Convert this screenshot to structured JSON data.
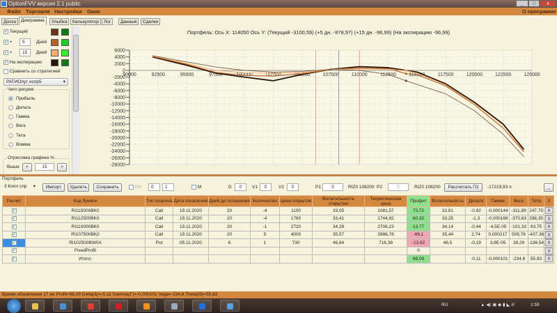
{
  "window": {
    "title": "OptionFVV версия 2.1 public",
    "minimize": "_",
    "maximize": "□",
    "close": "x"
  },
  "menu": {
    "items": [
      "Файл",
      "Торговля",
      "Настройки",
      "Окно"
    ],
    "about": "О программе"
  },
  "tabs": [
    "Доска",
    "Диаграмма",
    "Улыбка",
    "Калькулятор",
    "Лог",
    "Данные",
    "Сделки"
  ],
  "active_tab": "Диаграмма",
  "left_panel": {
    "series": [
      {
        "label": "Текущий",
        "checked": true,
        "color1": "#6b3518",
        "color2": "#0d7a1a"
      },
      {
        "prefix": "+",
        "days": "5",
        "label": "Дней",
        "checked": true,
        "color1": "#b5652a",
        "color2": "#22cc22"
      },
      {
        "prefix": "+",
        "days": "15",
        "label": "Дней",
        "checked": true,
        "color1": "#f5b070",
        "color2": "#33ee33"
      },
      {
        "label": "На экспирацию",
        "checked": true,
        "color1": "#2c1808",
        "color2": "#0d7a1a"
      }
    ],
    "compare_label": "Сравнить со стратегией",
    "compare_checked": false,
    "strategy_select": "РАТИОпут испр5",
    "draw_group": "Чего рисуем",
    "draw_options": [
      "Прибыль",
      "Дельта",
      "Гамма",
      "Вега",
      "Тета",
      "Вомма"
    ],
    "draw_selected": "Прибыль",
    "render_group": "Отрисовка графика %",
    "above_label": "Выше",
    "above_value": "15",
    "dec": "<",
    "inc": ">"
  },
  "chart_data": {
    "type": "line",
    "title": "Портфель:  Ось X:  114050  Ось Y:   (Текущий -3100,59)   (+5 дн. -978,97)   (+15 дн. -96,99)   (На экспирацию -96,99)",
    "xlim": [
      90000,
      125000
    ],
    "ylim": [
      -28000,
      6000
    ],
    "xticks": [
      90000,
      92500,
      95000,
      97500,
      100000,
      102500,
      105000,
      107500,
      110000,
      112500,
      115000,
      117500,
      120000,
      122500,
      125000
    ],
    "yticks": [
      6000,
      4000,
      2000,
      0,
      -2000,
      -4000,
      -6000,
      -8000,
      -10000,
      -12000,
      -14000,
      -16000,
      -18000,
      -20000,
      -22000,
      -24000,
      -26000,
      -28000
    ],
    "grid": true,
    "cursor_x": 114050,
    "current_price": 108200,
    "strike_markers": [
      106200,
      110000
    ],
    "series": [
      {
        "name": "Текущий",
        "color": "#2a1208",
        "x": [
          92000,
          95000,
          97500,
          100000,
          102500,
          105000,
          107500,
          110000,
          112500,
          115000,
          117500,
          120000,
          122500,
          124300
        ],
        "y": [
          4000,
          1500,
          -800,
          -2000,
          -3100,
          -1200,
          300,
          1100,
          800,
          -500,
          -4000,
          -9500,
          -16000,
          -23500
        ]
      },
      {
        "name": "+5",
        "color": "#b5652a",
        "x": [
          92000,
          95000,
          97500,
          100000,
          102500,
          105000,
          107500,
          110000,
          112500,
          114050,
          115000,
          117500,
          120000,
          122500,
          124300
        ],
        "y": [
          4200,
          1800,
          -600,
          -1500,
          -1700,
          -1000,
          300,
          700,
          500,
          -979,
          -1300,
          -4600,
          -10200,
          -17200,
          -24200
        ]
      },
      {
        "name": "+15",
        "color": "#f5b070",
        "x": [
          92000,
          95000,
          97500,
          100000,
          102500,
          105000,
          107500,
          110000,
          112500,
          114050,
          115000,
          117500,
          120000,
          122500,
          124300
        ],
        "y": [
          4300,
          2100,
          0,
          -700,
          -900,
          -600,
          300,
          400,
          300,
          -97,
          -800,
          -4300,
          -10000,
          -17000,
          -23900
        ]
      },
      {
        "name": "На экспирацию",
        "color": "#6b4a38",
        "x": [
          92000,
          95000,
          97500,
          100000,
          102500,
          105000,
          107500,
          110000,
          112500,
          114050,
          117500,
          120000,
          122500,
          124300
        ],
        "y": [
          4400,
          2500,
          1000,
          0,
          -500,
          -300,
          300,
          0,
          -1200,
          -3100,
          -7000,
          -12000,
          -19000,
          -25700
        ]
      }
    ]
  },
  "portfolio": {
    "label": "Портфель",
    "select": "3 Колл спр",
    "import": "Импорт",
    "delete": "Удалить",
    "save": "Сохранить",
    "dh_label": "DH",
    "spin1": "0",
    "spin2": "1",
    "m_label": "M",
    "d_label": "D",
    "d": "0",
    "v1_label": "V1",
    "v1": "0",
    "v2_label": "V2",
    "v2": "0",
    "p1_label": "P1",
    "p1": "0",
    "p1_ref": "RIZ0 108200",
    "p2_label": "P2",
    "p2": "0",
    "p2_ref": "RIZ0 108200",
    "calc_go": "Рассчитать ГО",
    "go_value": "-17219,93 п.",
    "collapse": "_",
    "columns": [
      "Расчет",
      "Код бумаги",
      "Тип опциона",
      "Дата погашения",
      "Дней до погашения",
      "Количество",
      "Цена открытия",
      "Волатильность открытия",
      "Теоретическая цена",
      "Профит",
      "Волатильность",
      "Дельта",
      "Гамма",
      "Вега",
      "Тета",
      "X"
    ],
    "rows": [
      {
        "code": "RI115000BK0",
        "type": "Call",
        "date": "19.11.2020",
        "days": "20",
        "qty": "-4",
        "price": "1100",
        "vol_open": "33,05",
        "theo": "1081,57",
        "profit": "73,72",
        "pc": "g",
        "vol": "32,81",
        "delta": "-0,92",
        "gamma": "-0,000144",
        "vega": "-311,89",
        "theta": "247,75"
      },
      {
        "code": "RI112500BK0",
        "type": "Call",
        "date": "19.11.2020",
        "days": "20",
        "qty": "-4",
        "price": "1760",
        "vol_open": "33,41",
        "theo": "1744,92",
        "profit": "60,32",
        "pc": "g",
        "vol": "33,25",
        "delta": "-1,3",
        "gamma": "-0,000168",
        "vega": "-370,63",
        "theta": "298,35"
      },
      {
        "code": "RI110000BK0",
        "type": "Call",
        "date": "19.11.2020",
        "days": "20",
        "qty": "-1",
        "price": "2720",
        "vol_open": "34,28",
        "theo": "2706,23",
        "profit": "13,77",
        "pc": "g",
        "vol": "34,14",
        "delta": "-0,44",
        "gamma": "-4,5E-05",
        "vega": "-101,33",
        "theta": "83,75"
      },
      {
        "code": "RI107500BK0",
        "type": "Call",
        "date": "19.11.2020",
        "days": "20",
        "qty": "5",
        "price": "4000",
        "vol_open": "35,57",
        "theo": "3986,78",
        "profit": "-66,1",
        "pc": "r",
        "vol": "35,44",
        "delta": "2,74",
        "gamma": "0,000217",
        "vega": "509,76",
        "theta": "-437,38"
      },
      {
        "code": "RI102500BW0A",
        "type": "Put",
        "date": "05.11.2020",
        "days": "6",
        "qty": "1",
        "price": "730",
        "vol_open": "46,84",
        "theo": "716,38",
        "profit": "-13,62",
        "pc": "r",
        "vol": "46,5",
        "delta": "-0,19",
        "gamma": "3,9E-05",
        "vega": "39,29",
        "theta": "-136,54",
        "selected": true
      },
      {
        "code": "FixedProfit",
        "type": "",
        "date": "",
        "days": "",
        "qty": "",
        "price": "",
        "vol_open": "",
        "theo": "",
        "profit": "0",
        "pc": "",
        "vol": "",
        "delta": "",
        "gamma": "",
        "vega": "",
        "theta": ""
      },
      {
        "code": "Итого:",
        "type": "",
        "date": "",
        "days": "",
        "qty": "",
        "price": "",
        "vol_open": "",
        "theo": "",
        "profit": "68,09",
        "pc": "g",
        "vol": "",
        "delta": "-0,11",
        "gamma": "-0,000101",
        "vega": "-234,8",
        "theta": "55,93"
      }
    ],
    "x_label": "X"
  },
  "status": "Время обновления 27 мс   Profit=68,09 Delta(Δ)=-0,11 Gamma(Γ)=-0,000101 Vega=-234,8 Theta(Θ)=55,93",
  "taskbar": {
    "lang": "RU",
    "time": "1:59",
    "apps": [
      "explorer",
      "remote-desktop",
      "chrome",
      "yandex-browser",
      "media-player",
      "tool",
      "opera",
      "optionfvv"
    ]
  }
}
